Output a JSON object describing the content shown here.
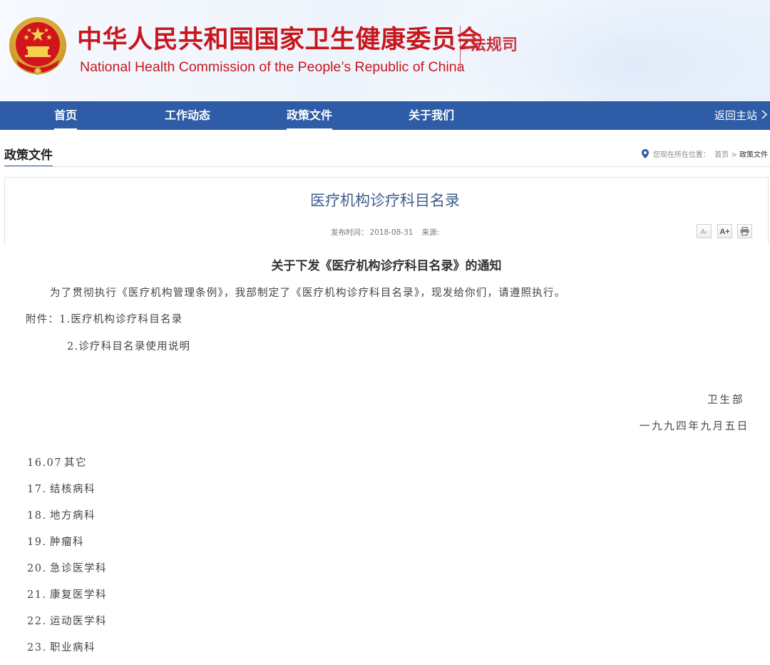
{
  "header": {
    "site_name_cn": "中华人民共和国国家卫生健康委员会",
    "site_name_en": "National Health Commission of the People’s  Republic of China",
    "dept_name": "法规司",
    "brand_color": "#c8161d",
    "emblem_icon": "national-emblem-icon"
  },
  "nav": {
    "bar_color": "#2e5ca6",
    "items": [
      {
        "label": "首页",
        "active": true
      },
      {
        "label": "工作动态",
        "active": false
      },
      {
        "label": "政策文件",
        "active": true
      },
      {
        "label": "关于我们",
        "active": false
      }
    ],
    "back_label": "返回主站",
    "back_icon": "chevron-right-icon"
  },
  "section": {
    "title": "政策文件",
    "breadcrumb_prefix": "您现在所在位置：",
    "breadcrumb_home": "首页",
    "breadcrumb_sep": " > ",
    "breadcrumb_current": "政策文件",
    "location_icon": "map-pin-icon"
  },
  "article": {
    "title": "医疗机构诊疗科目名录",
    "publish_label": "发布时间：",
    "publish_date": "2018-08-31",
    "source_label": "来源:",
    "tools": [
      "A-",
      "A+",
      "print-icon"
    ]
  },
  "document": {
    "heading": "关于下发《医疗机构诊疗科目名录》的通知",
    "body": "为了贯彻执行《医疗机构管理条例》，我部制定了《医疗机构诊疗科目名录》，现发给你们，请遵照执行。",
    "attachment_1": "附件：1.医疗机构诊疗科目名录",
    "attachment_2": "2.诊疗科目名录使用说明",
    "signer": "卫生部",
    "date": "一九九四年九月五日",
    "items": [
      {
        "num": "16.07",
        "name": "其它"
      },
      {
        "num": "17.",
        "name": "结核病科"
      },
      {
        "num": "18.",
        "name": "地方病科"
      },
      {
        "num": "19.",
        "name": "肿瘤科"
      },
      {
        "num": "20.",
        "name": "急诊医学科"
      },
      {
        "num": "21.",
        "name": "康复医学科"
      },
      {
        "num": "22.",
        "name": "运动医学科"
      },
      {
        "num": "23.",
        "name": "职业病科"
      }
    ]
  }
}
